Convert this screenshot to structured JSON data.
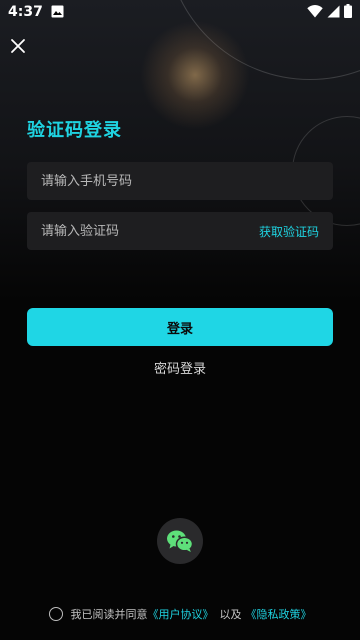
{
  "status_bar": {
    "time": "4:37",
    "icons": [
      "image-icon",
      "wifi-icon",
      "signal-icon",
      "battery-icon"
    ]
  },
  "header": {
    "close_icon": "close-icon",
    "title": "验证码登录"
  },
  "form": {
    "phone_placeholder": "请输入手机号码",
    "code_placeholder": "请输入验证码",
    "get_code_label": "获取验证码",
    "login_label": "登录",
    "password_login_label": "密码登录"
  },
  "social": {
    "wechat_icon": "wechat-icon"
  },
  "agreement": {
    "prefix": "我已阅读并同意",
    "user_agreement": "《用户协议》",
    "connector": "以及",
    "privacy_policy": "《隐私政策》"
  },
  "colors": {
    "accent": "#1fd3e1",
    "background": "#050505",
    "field_background": "#1e1e20",
    "button_text": "#0b0b0b"
  }
}
